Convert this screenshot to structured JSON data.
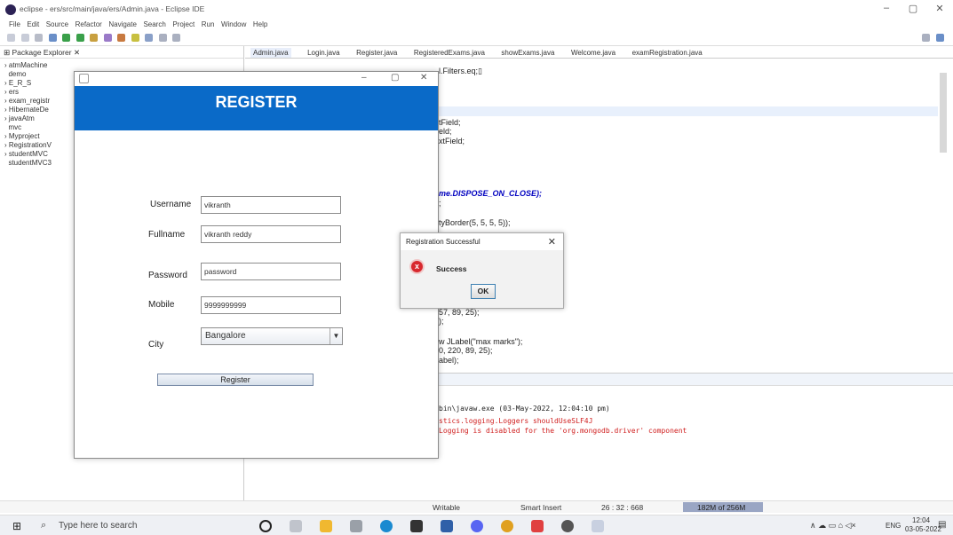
{
  "window": {
    "title": "eclipse - ers/src/main/java/ers/Admin.java - Eclipse IDE"
  },
  "menu": [
    "File",
    "Edit",
    "Source",
    "Refactor",
    "Navigate",
    "Search",
    "Project",
    "Run",
    "Window",
    "Help"
  ],
  "package_explorer": {
    "title": "Package Explorer",
    "items": [
      "atmMachine",
      "demo",
      "E_R_S",
      "ers",
      "exam_registr",
      "HibernateDe",
      "javaAtm",
      "mvc",
      "Myproject",
      "RegistrationV",
      "studentMVC",
      "studentMVC3"
    ]
  },
  "editor_tabs": [
    "Admin.java",
    "Login.java",
    "Register.java",
    "RegisteredExams.java",
    "showExams.java",
    "Welcome.java",
    "examRegistration.java"
  ],
  "code_lines": [
    {
      "text": "l.Filters.eq;▯"
    },
    {
      "text": "tField;"
    },
    {
      "text": "eld;"
    },
    {
      "text": "xtField;"
    },
    {
      "text": "me.DISPOSE_ON_CLOSE);"
    },
    {
      "text": ";"
    },
    {
      "text": "tyBorder(5, 5, 5, 5));"
    },
    {
      "text": "57, 89, 25);"
    },
    {
      "text": ");"
    },
    {
      "text": "w JLabel(\"max marks\");"
    },
    {
      "text": "0, 220, 89, 25);"
    },
    {
      "text": "abel);"
    }
  ],
  "console": {
    "header": "bin\\javaw.exe  (03-May-2022, 12:04:10 pm)",
    "line1": "stics.logging.Loggers shouldUseSLF4J",
    "line2": " Logging is disabled for the 'org.mongodb.driver' component"
  },
  "status": {
    "writable": "Writable",
    "insert_mode": "Smart Insert",
    "position": "26 : 32 : 668",
    "heap": "182M of 256M"
  },
  "register_window": {
    "header": "REGISTER",
    "username_label": "Username",
    "username_value": "vikranth",
    "fullname_label": "Fullname",
    "fullname_value": "vikranth reddy",
    "password_label": "Password",
    "password_value": "password",
    "mobile_label": "Mobile",
    "mobile_value": "9999999999",
    "city_label": "City",
    "city_value": "Bangalore",
    "register_button": "Register"
  },
  "dialog": {
    "title": "Registration Successful",
    "message": "Success",
    "ok_button": "OK"
  },
  "taskbar": {
    "search_placeholder": "Type here to search",
    "lang": "ENG",
    "time": "12:04",
    "date": "03-05-2022"
  }
}
